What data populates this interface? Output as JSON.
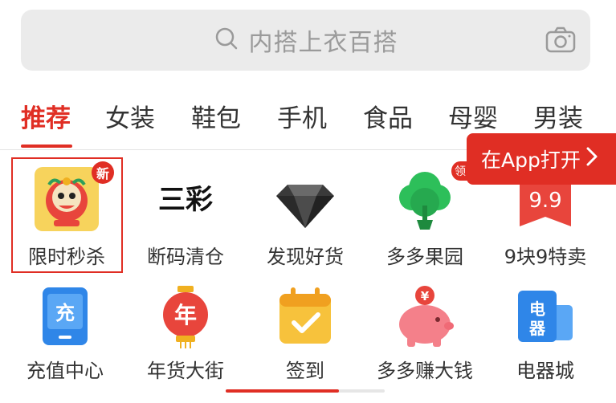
{
  "search": {
    "placeholder": "内搭上衣百搭"
  },
  "tabs": [
    "推荐",
    "女装",
    "鞋包",
    "手机",
    "食品",
    "母婴",
    "男装"
  ],
  "open_app": {
    "label": "在App打开"
  },
  "badges": {
    "new": "新",
    "ling": "领"
  },
  "grid_row1": [
    {
      "label": "限时秒杀",
      "icon": "lion-dance-icon"
    },
    {
      "label": "断码清仓",
      "icon": "sancai-logo-icon",
      "icon_text": "三彩"
    },
    {
      "label": "发现好货",
      "icon": "diamond-icon"
    },
    {
      "label": "多多果园",
      "icon": "tree-icon"
    },
    {
      "label": "9块9特卖",
      "icon": "price-tag-icon",
      "icon_text": "9.9"
    }
  ],
  "grid_row2": [
    {
      "label": "充值中心",
      "icon": "phone-recharge-icon",
      "icon_text": "充"
    },
    {
      "label": "年货大街",
      "icon": "lantern-icon",
      "icon_text": "年"
    },
    {
      "label": "签到",
      "icon": "calendar-check-icon"
    },
    {
      "label": "多多赚大钱",
      "icon": "piggy-bank-icon",
      "icon_text": "¥"
    },
    {
      "label": "电器城",
      "icon": "appliance-icon",
      "icon_text": "电器"
    }
  ],
  "colors": {
    "accent": "#e02e24",
    "text": "#333333",
    "placeholder": "#9a9a9a"
  },
  "scroll_progress": 0.71
}
